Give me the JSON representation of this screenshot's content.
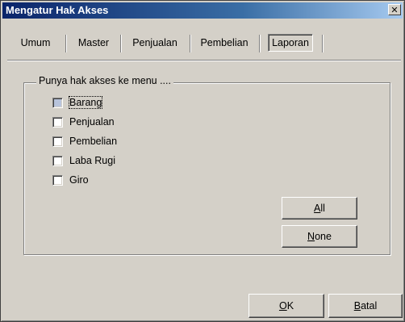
{
  "window": {
    "title": "Mengatur Hak Akses",
    "close_glyph": "✕"
  },
  "tabs": [
    {
      "label": "Umum",
      "active": false
    },
    {
      "label": "Master",
      "active": false
    },
    {
      "label": "Penjualan",
      "active": false
    },
    {
      "label": "Pembelian",
      "active": false
    },
    {
      "label": "Laporan",
      "active": true
    }
  ],
  "group": {
    "label": "Punya hak akses ke menu ....",
    "items": [
      {
        "label": "Barang",
        "checked": false,
        "focused": true
      },
      {
        "label": "Penjualan",
        "checked": false,
        "focused": false
      },
      {
        "label": "Pembelian",
        "checked": false,
        "focused": false
      },
      {
        "label": "Laba Rugi",
        "checked": false,
        "focused": false
      },
      {
        "label": "Giro",
        "checked": false,
        "focused": false
      }
    ]
  },
  "buttons": {
    "all": {
      "accel": "A",
      "rest": "ll"
    },
    "none": {
      "accel": "N",
      "rest": "one"
    },
    "ok": {
      "accel": "O",
      "rest": "K"
    },
    "batal": {
      "accel": "B",
      "rest": "atal"
    }
  }
}
